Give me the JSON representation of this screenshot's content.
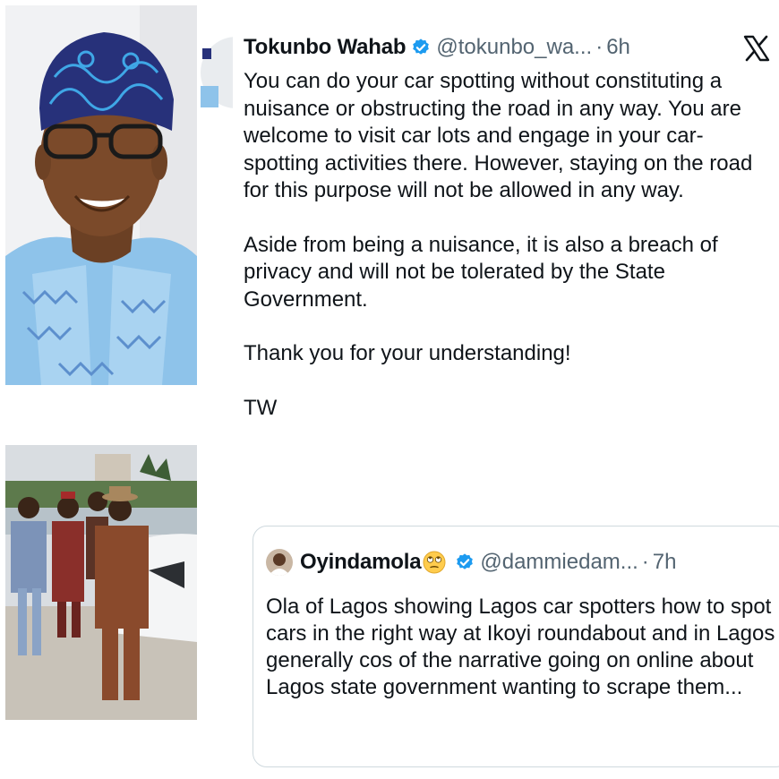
{
  "tweet": {
    "author_name": "Tokunbo Wahab",
    "handle": "@tokunbo_wa...",
    "separator": "·",
    "time": "6h",
    "paragraphs": [
      "You can do your car spotting without constituting a nuisance or obstructing the road in any way. You are welcome to visit car lots and engage in your car-spotting activities there. However, staying on the road for this purpose will not be allowed in any way.",
      "Aside from being a nuisance, it is also a breach of privacy and will not be tolerated by the State Government.",
      "Thank you for your understanding!",
      "TW"
    ]
  },
  "quote": {
    "author_name": "Oyindamola",
    "handle": "@dammiedam...",
    "separator": "·",
    "time": "7h",
    "text": "Ola of Lagos showing Lagos car spotters how to spot cars in the right way at Ikoyi roundabout and in Lagos generally cos of the narrative going on online about Lagos state government wanting to scrape them..."
  },
  "colors": {
    "verified": "#1d9bf0",
    "secondary_text": "#536471",
    "border": "#cfd9de"
  },
  "icons": [
    "verified-badge-icon",
    "x-logo-icon",
    "eye-roll-emoji-icon"
  ]
}
